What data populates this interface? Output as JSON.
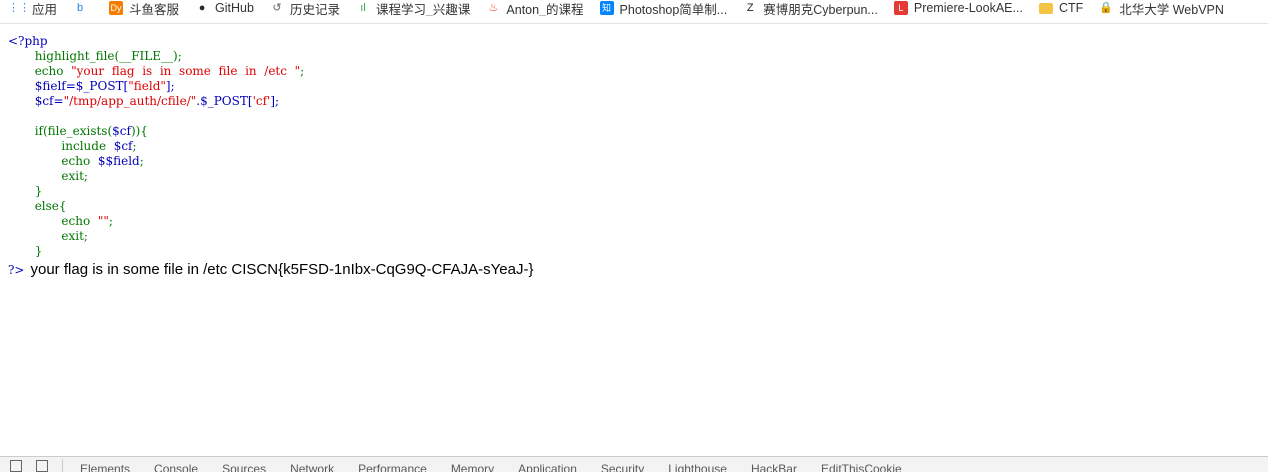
{
  "bookmarks": [
    {
      "label": "应用",
      "icon": "apps-grid-icon",
      "color": "#4285f4"
    },
    {
      "label": "",
      "icon": "bing-icon",
      "color": "#1e88e5"
    },
    {
      "label": "斗鱼客服",
      "icon": "douyu-icon",
      "color": "#f57c00"
    },
    {
      "label": "GitHub",
      "icon": "github-icon",
      "color": "#24292e"
    },
    {
      "label": "历史记录",
      "icon": "history-icon",
      "color": "#5f6368"
    },
    {
      "label": "课程学习_兴趣课",
      "icon": "course-icon",
      "color": "#34a853"
    },
    {
      "label": "Anton_的课程",
      "icon": "flame-icon",
      "color": "#e53935"
    },
    {
      "label": "Photoshop简单制...",
      "icon": "zhihu-icon",
      "color": "#0084ff"
    },
    {
      "label": "赛博朋克Cyberpun...",
      "icon": "zcool-icon",
      "color": "#222222"
    },
    {
      "label": "Premiere-LookAE...",
      "icon": "lookae-icon",
      "color": "#e53935"
    },
    {
      "label": "CTF",
      "icon": "folder-icon",
      "color": "#f4c542"
    },
    {
      "label": "北华大学 WebVPN",
      "icon": "lock-icon",
      "color": "#1ba784"
    }
  ],
  "code": {
    "open_tag": "<?php",
    "line1_fn": "highlight_file(__FILE__);",
    "line2_kw": "echo",
    "line2_str": "\"your  flag  is  in  some  file  in  /etc  \"",
    "line2_end": ";",
    "line3_var": "$fielf=$_POST[",
    "line3_str": "\"field\"",
    "line3_end": "];",
    "line4_var": "$cf=",
    "line4_str": "\"/tmp/app_auth/cfile/\"",
    "line4_mid": ".$_POST[",
    "line4_str2": "'cf'",
    "line4_end": "];",
    "line6_kw": "if(file_exists(",
    "line6_var": "$cf",
    "line6_end": ")){",
    "line7_kw": "include",
    "line7_var": "$cf",
    "line7_end": ";",
    "line8_kw": "echo",
    "line8_var": "$$field",
    "line8_end": ";",
    "line9_kw": "exit;",
    "line10": "}",
    "line11": "else{",
    "line12_kw": "echo",
    "line12_str": "\"\"",
    "line12_end": ";",
    "line13_kw": "exit;",
    "line14": "}",
    "close_tag": "?>",
    "output": "your flag is in some file in /etc CISCN{k5FSD-1nIbx-CqG9Q-CFAJA-sYeaJ-}"
  },
  "devtools": {
    "tabs": [
      "Elements",
      "Console",
      "Sources",
      "Network",
      "Performance",
      "Memory",
      "Application",
      "Security",
      "Lighthouse",
      "HackBar",
      "EditThisCookie"
    ]
  }
}
